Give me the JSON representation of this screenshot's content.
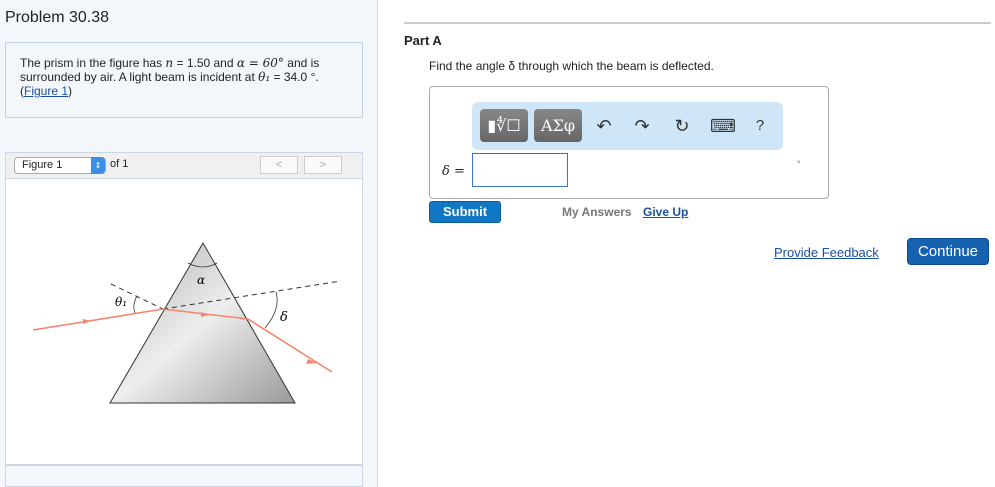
{
  "title": "Problem 30.38",
  "problem": {
    "t1": "The prism in the figure has ",
    "n": "n",
    "t2": " = 1.50 and ",
    "alpha": "α = 60°",
    "t3": " and is surrounded by air. A light beam is incident at ",
    "theta": "θ₁",
    "t4": " = 34.0 °. (",
    "link": "Figure 1",
    "t5": ")"
  },
  "figure_nav": {
    "select": "Figure 1",
    "of": "of 1",
    "prev": "<",
    "next": ">"
  },
  "figure_labels": {
    "alpha": "α",
    "theta": "θ₁",
    "delta": "δ"
  },
  "part": "Part A",
  "question": "Find the angle δ through which the beam is deflected.",
  "toolbar": {
    "templates": "▮∜☐",
    "greek": "ΑΣφ",
    "undo": "↶",
    "redo": "↷",
    "reset": "↻",
    "keyboard": "⌨",
    "help": "?"
  },
  "answer": {
    "label": "δ =",
    "value": "",
    "unit": "°"
  },
  "buttons": {
    "submit": "Submit",
    "my_answers": "My Answers",
    "give_up": "Give Up",
    "feedback": "Provide Feedback",
    "continue": "Continue"
  }
}
